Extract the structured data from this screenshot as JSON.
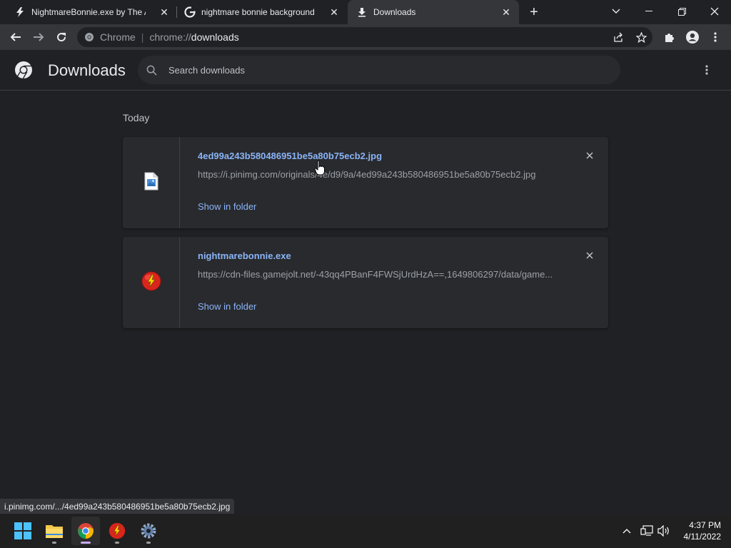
{
  "tabs": [
    {
      "title": "NightmareBonnie.exe by The Aq",
      "icon": "lightning-icon",
      "active": false
    },
    {
      "title": "nightmare bonnie background - ",
      "icon": "google-icon",
      "active": false
    },
    {
      "title": "Downloads",
      "icon": "download-icon",
      "active": true
    }
  ],
  "address_bar": {
    "chip": "Chrome",
    "scheme": "chrome://",
    "host": "downloads"
  },
  "header": {
    "title": "Downloads",
    "search_placeholder": "Search downloads"
  },
  "section_label": "Today",
  "downloads": [
    {
      "file_name": "4ed99a243b580486951be5a80b75ecb2.jpg",
      "url": "https://i.pinimg.com/originals/4e/d9/9a/4ed99a243b580486951be5a80b75ecb2.jpg",
      "action": "Show in folder",
      "icon": "image-file-icon"
    },
    {
      "file_name": "nightmarebonnie.exe",
      "url": "https://cdn-files.gamejolt.net/-43qq4PBanF4FWSjUrdHzA==,1649806297/data/game...",
      "action": "Show in folder",
      "icon": "gamejolt-app-icon"
    }
  ],
  "status_bar": "i.pinimg.com/.../4ed99a243b580486951be5a80b75ecb2.jpg",
  "clock": {
    "time": "4:37 PM",
    "date": "4/11/2022"
  },
  "colors": {
    "accent_link": "#8ab4f8",
    "background": "#202124",
    "card": "#292a2d"
  }
}
